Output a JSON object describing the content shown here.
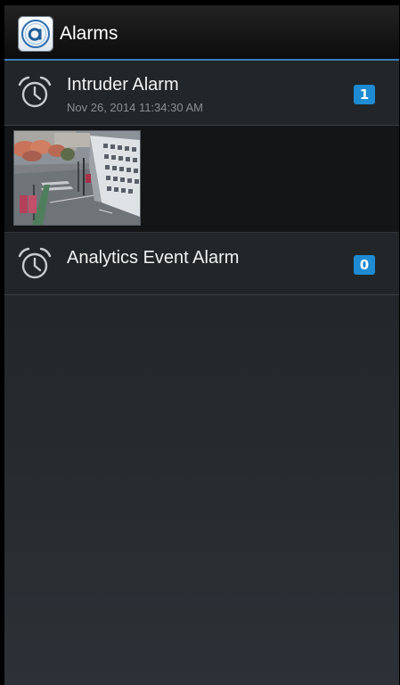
{
  "header": {
    "title": "Alarms",
    "app_icon": "a-logo-icon"
  },
  "alarms": [
    {
      "title": "Intruder Alarm",
      "time": "Nov 26, 2014 11:34:30 AM",
      "count": "1",
      "icon": "alarm-clock-icon",
      "thumbnail": "camera-snapshot"
    },
    {
      "title": "Analytics Event Alarm",
      "count": "0",
      "icon": "alarm-clock-icon"
    }
  ],
  "colors": {
    "accent": "#3a7dbf",
    "badge": "#1e8bd2",
    "background": "#23272b"
  }
}
